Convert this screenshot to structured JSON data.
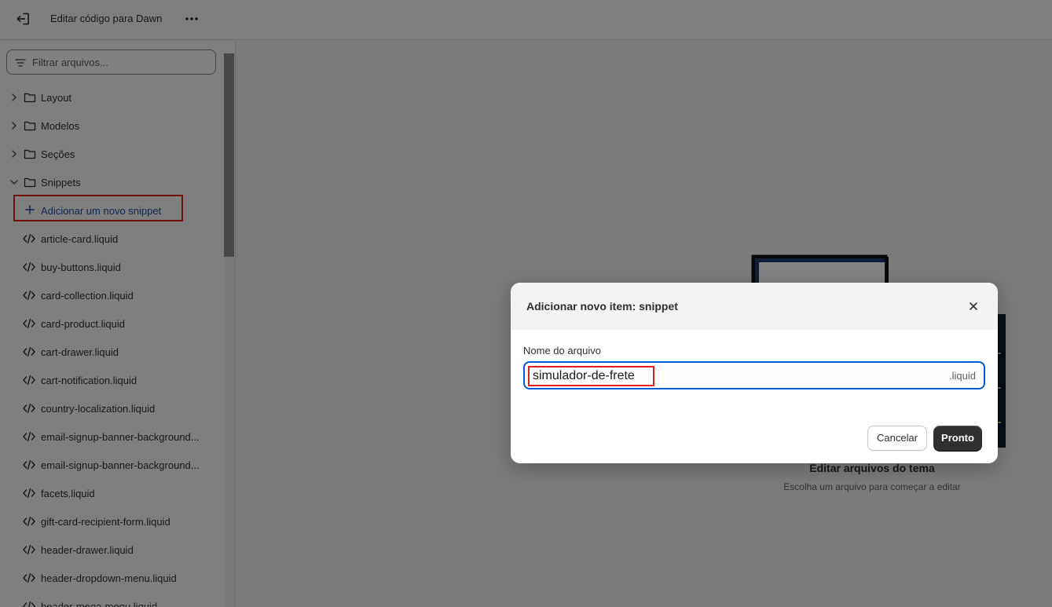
{
  "topbar": {
    "title": "Editar código para Dawn",
    "exit_icon": "exit-icon",
    "more_icon": "more-horizontal-icon"
  },
  "sidebar": {
    "filter_placeholder": "Filtrar arquivos...",
    "folders": [
      {
        "label": "Layout",
        "expanded": false
      },
      {
        "label": "Modelos",
        "expanded": false
      },
      {
        "label": "Seções",
        "expanded": false
      },
      {
        "label": "Snippets",
        "expanded": true
      }
    ],
    "add_snippet_label": "Adicionar um novo snippet",
    "files": [
      "article-card.liquid",
      "buy-buttons.liquid",
      "card-collection.liquid",
      "card-product.liquid",
      "cart-drawer.liquid",
      "cart-notification.liquid",
      "country-localization.liquid",
      "email-signup-banner-background...",
      "email-signup-banner-background...",
      "facets.liquid",
      "gift-card-recipient-form.liquid",
      "header-drawer.liquid",
      "header-dropdown-menu.liquid",
      "header-mega-menu.liquid"
    ]
  },
  "main": {
    "empty_title": "Editar arquivos do tema",
    "empty_subtitle": "Escolha um arquivo para começar a editar"
  },
  "modal": {
    "title": "Adicionar novo item: snippet",
    "field_label": "Nome do arquivo",
    "field_value": "simulador-de-frete",
    "field_suffix": ".liquid",
    "cancel_label": "Cancelar",
    "done_label": "Pronto"
  },
  "colors": {
    "accent_focus": "#005bd3",
    "link": "#1b4ea0",
    "annotation_red": "#e0201d",
    "primary_button": "#303030"
  }
}
